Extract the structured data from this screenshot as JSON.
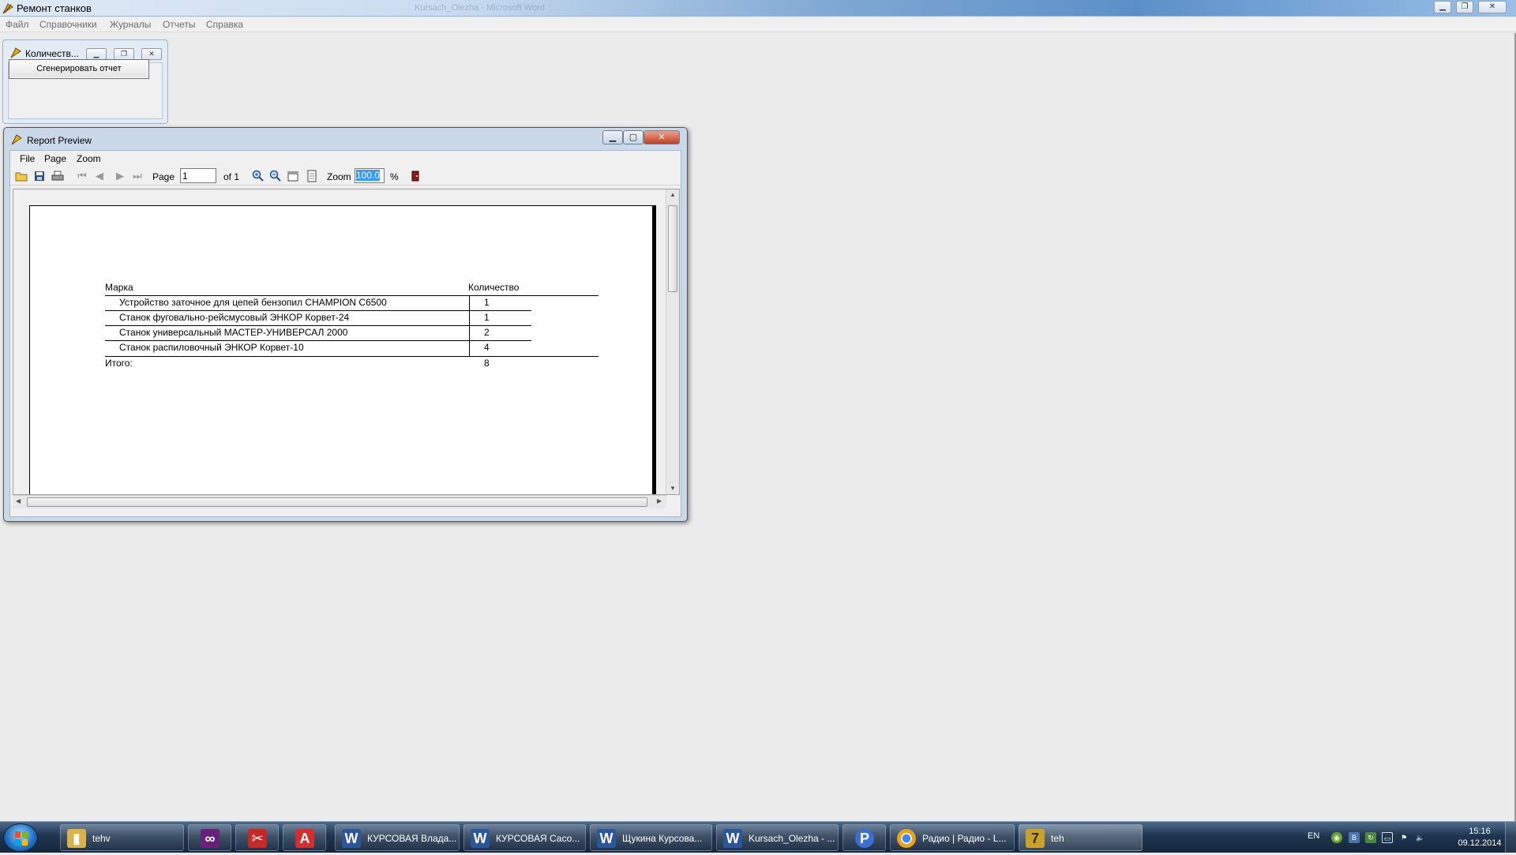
{
  "main_window": {
    "title": "Ремонт станков",
    "background_title": "Kursach_Olezha - Microsoft Word",
    "menu": [
      "Файл",
      "Справочники",
      "Журналы",
      "Отчеты",
      "Справка"
    ]
  },
  "child_window": {
    "title": "Количеств...",
    "generate_button": "Сгенерировать отчет"
  },
  "report_preview": {
    "title": "Report Preview",
    "menu": [
      "File",
      "Page",
      "Zoom"
    ],
    "toolbar": {
      "page_label": "Page",
      "page_value": "1",
      "of_label": "of 1",
      "zoom_label": "Zoom",
      "zoom_value": "100.0",
      "percent": "%"
    },
    "report": {
      "col_brand": "Марка",
      "col_qty": "Количество",
      "rows": [
        {
          "name": "Устройство заточное для цепей бензопил CHAMPION C6500",
          "qty": "1"
        },
        {
          "name": "Станок фуговально-рейсмусовый ЭНКОР Корвет-24",
          "qty": "1"
        },
        {
          "name": "Станок универсальный МАСТЕР-УНИВЕРСАЛ 2000",
          "qty": "2"
        },
        {
          "name": "Станок распиловочный ЭНКОР Корвет-10",
          "qty": "4"
        }
      ],
      "total_label": "Итого:",
      "total_value": "8"
    }
  },
  "taskbar": {
    "items": [
      {
        "label": "tehv",
        "icon": "folder-icon",
        "color": "#d9b24a"
      },
      {
        "label": "",
        "icon": "visual-studio-icon",
        "color": "#68217a"
      },
      {
        "label": "",
        "icon": "snipping-tool-icon",
        "color": "#c62828"
      },
      {
        "label": "",
        "icon": "acrobat-icon",
        "color": "#d32f2f"
      },
      {
        "label": "КУРСОВАЯ Влада...",
        "icon": "word-icon",
        "color": "#2b579a"
      },
      {
        "label": "КУРСОВАЯ Сасо...",
        "icon": "word-icon",
        "color": "#2b579a"
      },
      {
        "label": "Щукина Курсова...",
        "icon": "word-icon",
        "color": "#2b579a"
      },
      {
        "label": "Kursach_Olezha - ...",
        "icon": "word-icon",
        "color": "#2b579a"
      },
      {
        "label": "",
        "icon": "p-app-icon",
        "color": "#3b6fd1"
      },
      {
        "label": "Радио | Радио - L...",
        "icon": "chrome-icon",
        "color": "#e8a317"
      },
      {
        "label": "teh",
        "icon": "delphi-icon",
        "color": "#c9a227"
      }
    ],
    "language": "EN",
    "time": "15:16",
    "date": "09.12.2014"
  }
}
